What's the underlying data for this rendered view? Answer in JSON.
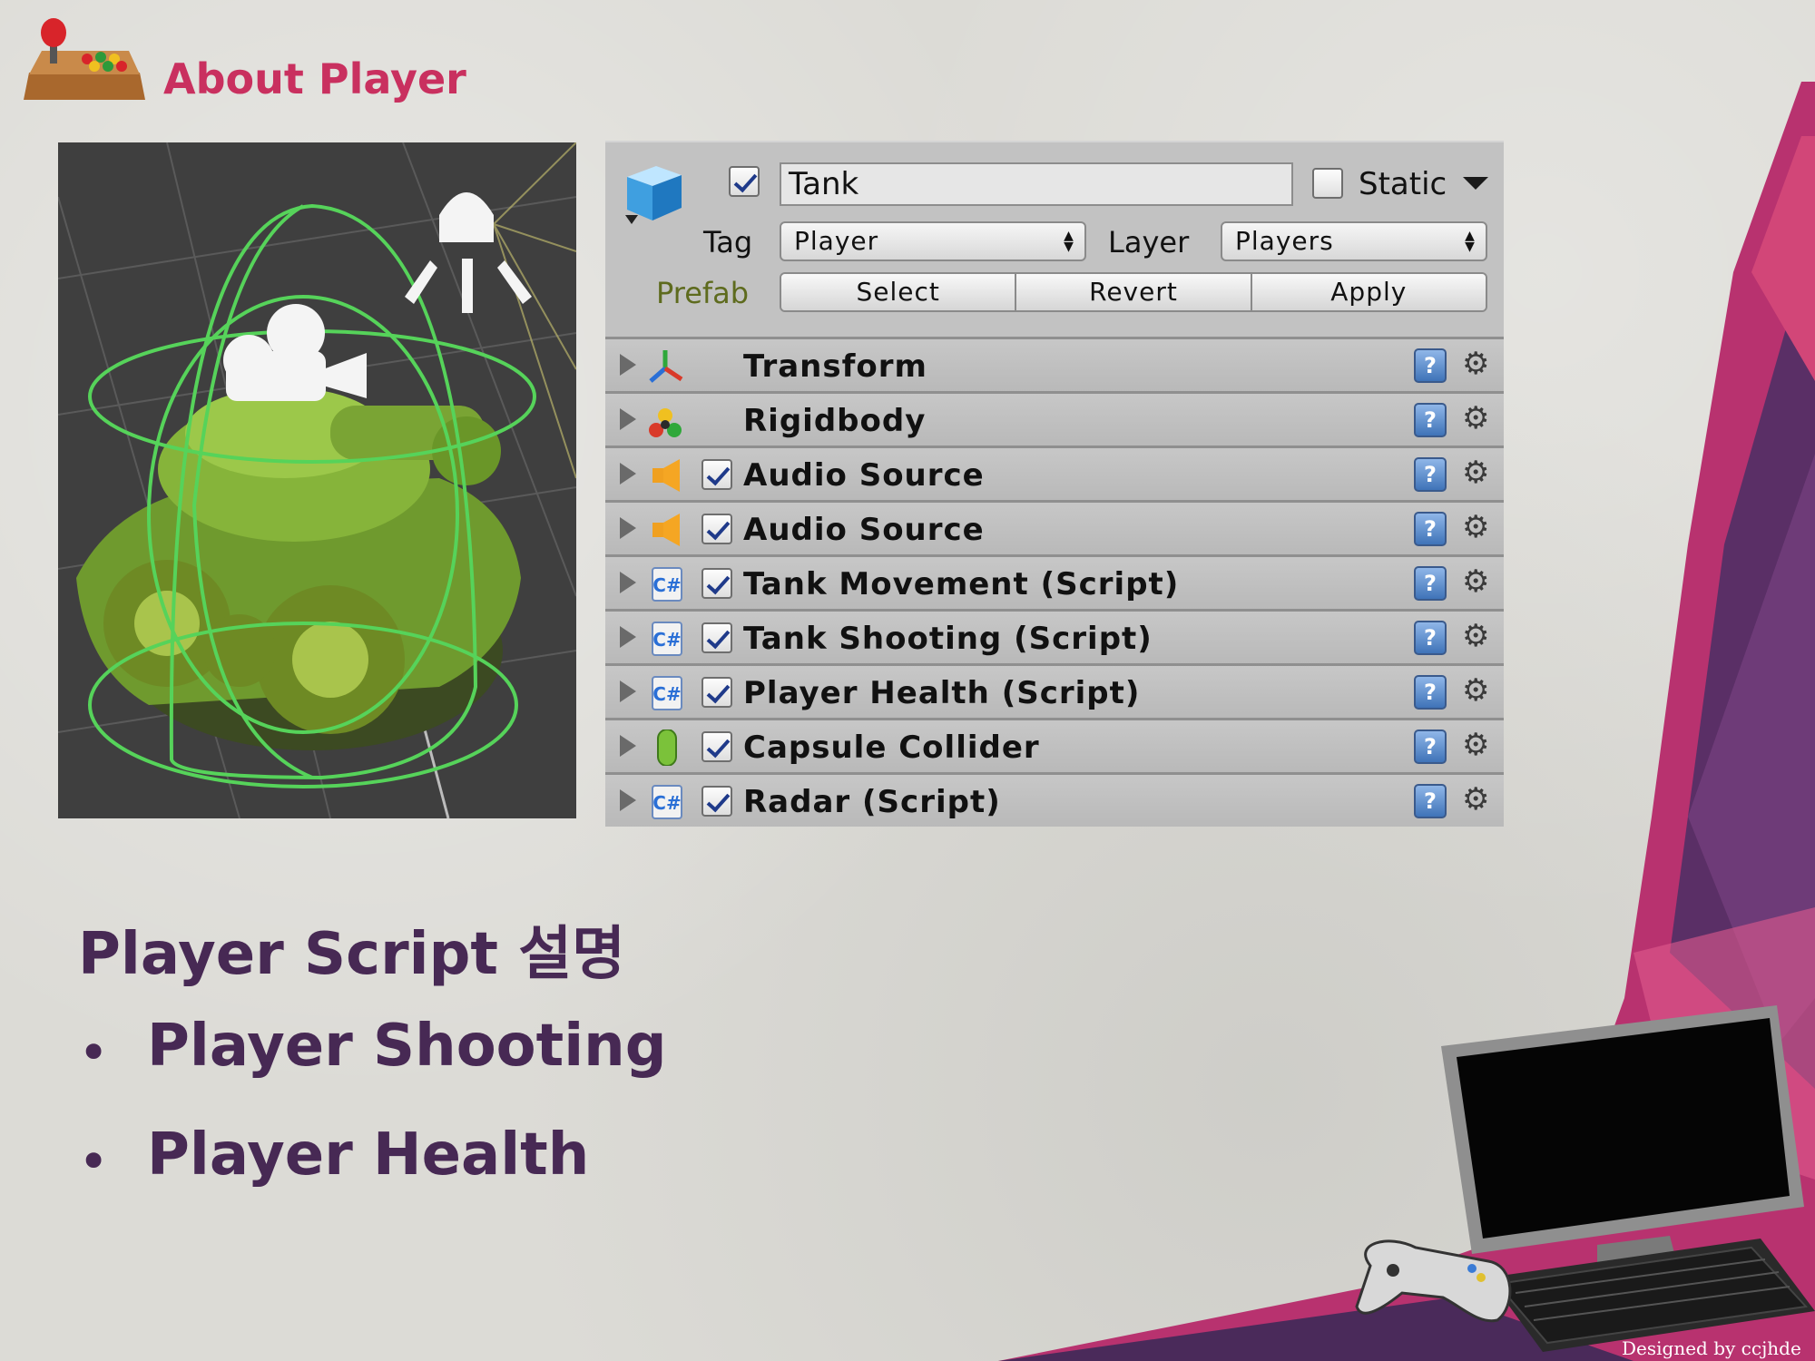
{
  "slide": {
    "title": "About Player",
    "credit": "Designed by ccjhde"
  },
  "inspector": {
    "object_name": "Tank",
    "active_checked": true,
    "static_label": "Static",
    "static_checked": false,
    "tag_label": "Tag",
    "tag_value": "Player",
    "layer_label": "Layer",
    "layer_value": "Players",
    "prefab_label": "Prefab",
    "prefab_buttons": [
      "Select",
      "Revert",
      "Apply"
    ],
    "components": [
      {
        "name": "Transform",
        "icon": "transform-icon",
        "has_checkbox": false
      },
      {
        "name": "Rigidbody",
        "icon": "rigidbody-icon",
        "has_checkbox": false
      },
      {
        "name": "Audio Source",
        "icon": "audio-source-icon",
        "has_checkbox": true
      },
      {
        "name": "Audio Source",
        "icon": "audio-source-icon",
        "has_checkbox": true
      },
      {
        "name": "Tank Movement (Script)",
        "icon": "csharp-script-icon",
        "has_checkbox": true
      },
      {
        "name": "Tank Shooting (Script)",
        "icon": "csharp-script-icon",
        "has_checkbox": true
      },
      {
        "name": "Player Health (Script)",
        "icon": "csharp-script-icon",
        "has_checkbox": true
      },
      {
        "name": "Capsule Collider",
        "icon": "capsule-collider-icon",
        "has_checkbox": true
      },
      {
        "name": "Radar (Script)",
        "icon": "csharp-script-icon",
        "has_checkbox": true
      }
    ]
  },
  "content": {
    "heading": "Player Script 설명",
    "bullets": [
      "Player Shooting",
      "Player Health"
    ]
  },
  "colors": {
    "title": "#c9305f",
    "body_text": "#472954"
  }
}
